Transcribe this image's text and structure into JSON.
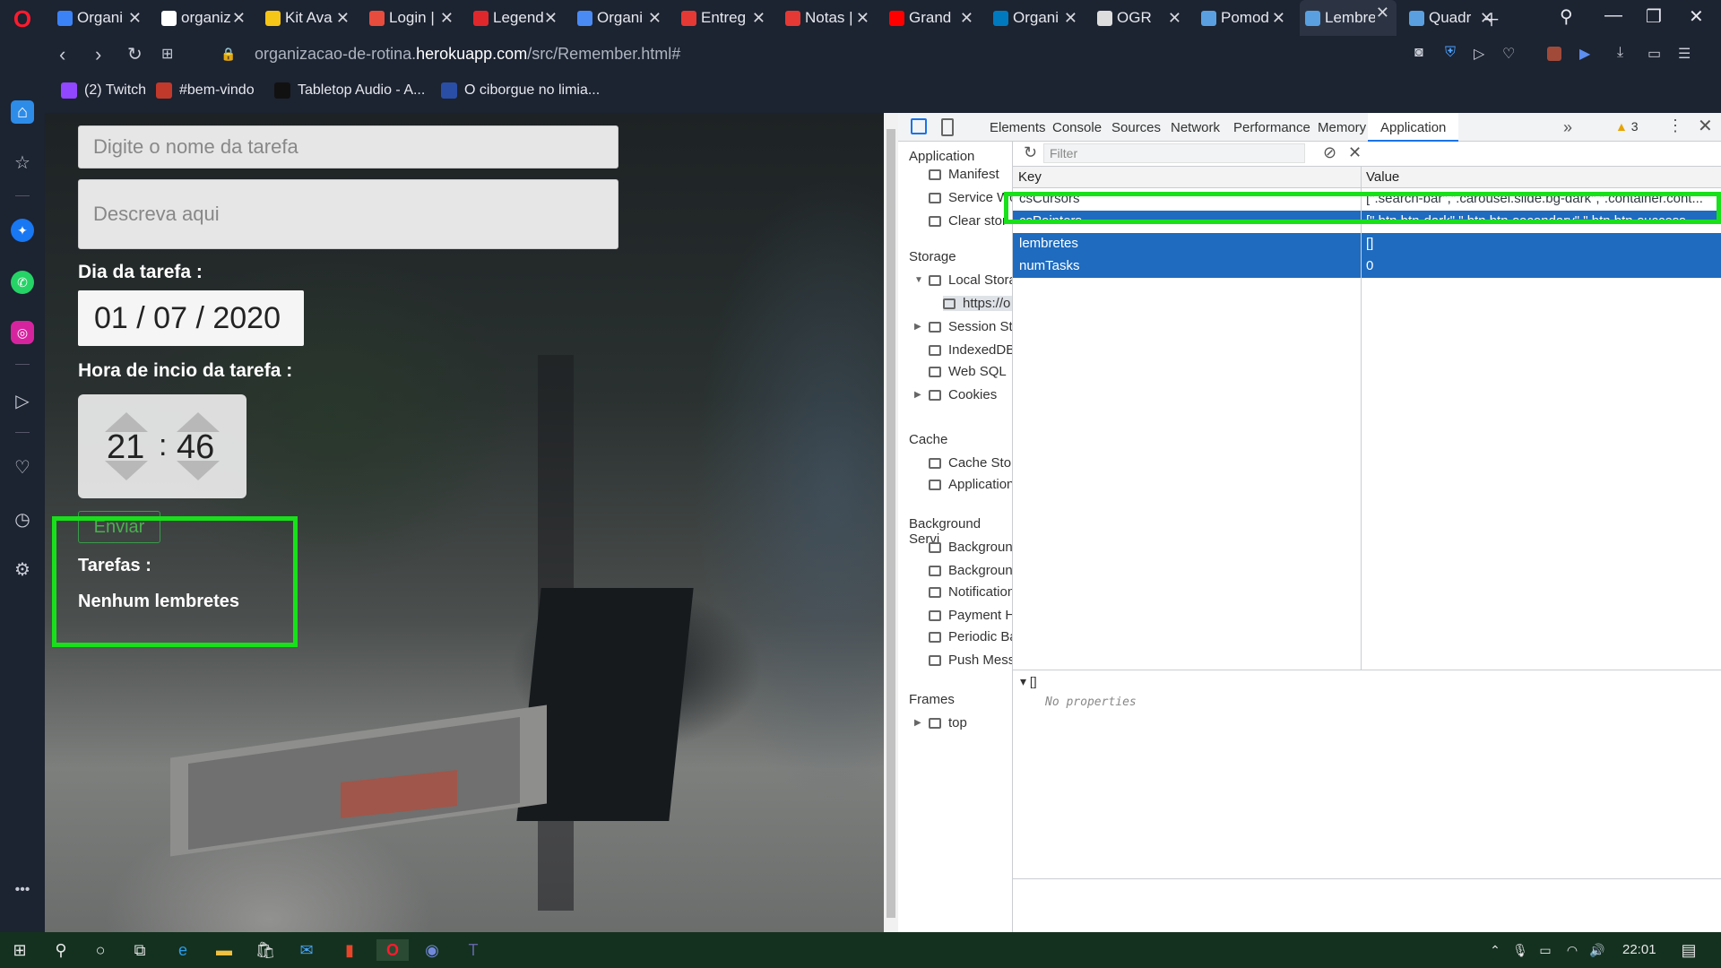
{
  "tabs": [
    {
      "label": "Organi",
      "icon": "m-app-icon",
      "color": "#3b82f6"
    },
    {
      "label": "organiz",
      "icon": "github-icon",
      "color": "#ffffff"
    },
    {
      "label": "Kit Ava",
      "icon": "bolt-icon",
      "color": "#f5c518"
    },
    {
      "label": "Login |",
      "icon": "grid-app-icon",
      "color": "#e84c3d"
    },
    {
      "label": "Legend",
      "icon": "b-logo-icon",
      "color": "#e0282c"
    },
    {
      "label": "Organi",
      "icon": "doc-icon",
      "color": "#4a8af4"
    },
    {
      "label": "Entreg",
      "icon": "spinner-icon",
      "color": "#e53935"
    },
    {
      "label": "Notas |",
      "icon": "spinner-icon",
      "color": "#e53935"
    },
    {
      "label": "Grand",
      "icon": "youtube-icon",
      "color": "#ff0000"
    },
    {
      "label": "Organi",
      "icon": "trello-icon",
      "color": "#0079bf"
    },
    {
      "label": "OGR",
      "icon": "page-icon",
      "color": "#dddddd"
    },
    {
      "label": "Pomod",
      "icon": "brain-icon",
      "color": "#5aa0e0"
    },
    {
      "label": "Lembre",
      "icon": "brain-icon",
      "color": "#5aa0e0"
    },
    {
      "label": "Quadr",
      "icon": "brain-icon",
      "color": "#5aa0e0"
    }
  ],
  "address": {
    "prefix": "organizacao-de-rotina.",
    "domain": "herokuapp.com",
    "path": "/src/Remember.html#"
  },
  "bookmarks": [
    {
      "label": "(2) Twitch",
      "icon": "twitch-icon",
      "color": "#9146ff"
    },
    {
      "label": "#bem-vindo",
      "icon": "app-icon",
      "color": "#c0392b"
    },
    {
      "label": "Tabletop Audio - A...",
      "icon": "tabletop-icon",
      "color": "#111111"
    },
    {
      "label": "O ciborgue no limia...",
      "icon": "e-icon",
      "color": "#2a4ea6"
    }
  ],
  "form": {
    "task_name_placeholder": "Digite o nome da tarefa",
    "desc_placeholder": "Descreva aqui",
    "day_label": "Dia da tarefa :",
    "date_day": "01",
    "date_month": "07",
    "date_year": "2020",
    "time_label": "Hora de incio da tarefa :",
    "hour": "21",
    "minute": "46",
    "send_label": "Enviar",
    "tasks_label": "Tarefas :",
    "empty_label": "Nenhum lembretes"
  },
  "devtools": {
    "tabs": [
      "Elements",
      "Console",
      "Sources",
      "Network",
      "Performance",
      "Memory",
      "Application"
    ],
    "active_tab": "Application",
    "warnings": "3",
    "filter_placeholder": "Filter",
    "sidebar": {
      "application_title": "Application",
      "application_items": [
        "Manifest",
        "Service Wo",
        "Clear stor"
      ],
      "storage_title": "Storage",
      "storage_items": [
        "Local Stora",
        "https://o",
        "Session Sto",
        "IndexedDB",
        "Web SQL",
        "Cookies"
      ],
      "cache_title": "Cache",
      "cache_items": [
        "Cache Stor",
        "Application"
      ],
      "bg_title": "Background Servi",
      "bg_items": [
        "Backgroun",
        "Backgroun",
        "Notification",
        "Payment H",
        "Periodic Ba",
        "Push Mess"
      ],
      "frames_title": "Frames",
      "frames_items": [
        "top"
      ]
    },
    "table": {
      "key_header": "Key",
      "value_header": "Value",
      "rows": [
        {
          "key": "csCursors",
          "value": "[\".search-bar\",\".carousel.slide.bg-dark\",\".container.cont..."
        },
        {
          "key": "csPointers",
          "value": "[\".btn.btn-dark\",\".btn.btn-secondary\",\".btn.btn-success"
        },
        {
          "key": "lembretes",
          "value": "[]"
        },
        {
          "key": "numTasks",
          "value": "0"
        }
      ],
      "selected_key": "lembretes"
    },
    "preview": {
      "title": "[]",
      "empty": "No properties"
    }
  },
  "taskbar": {
    "time": "22:01"
  },
  "highlight_color": "#18e01a"
}
